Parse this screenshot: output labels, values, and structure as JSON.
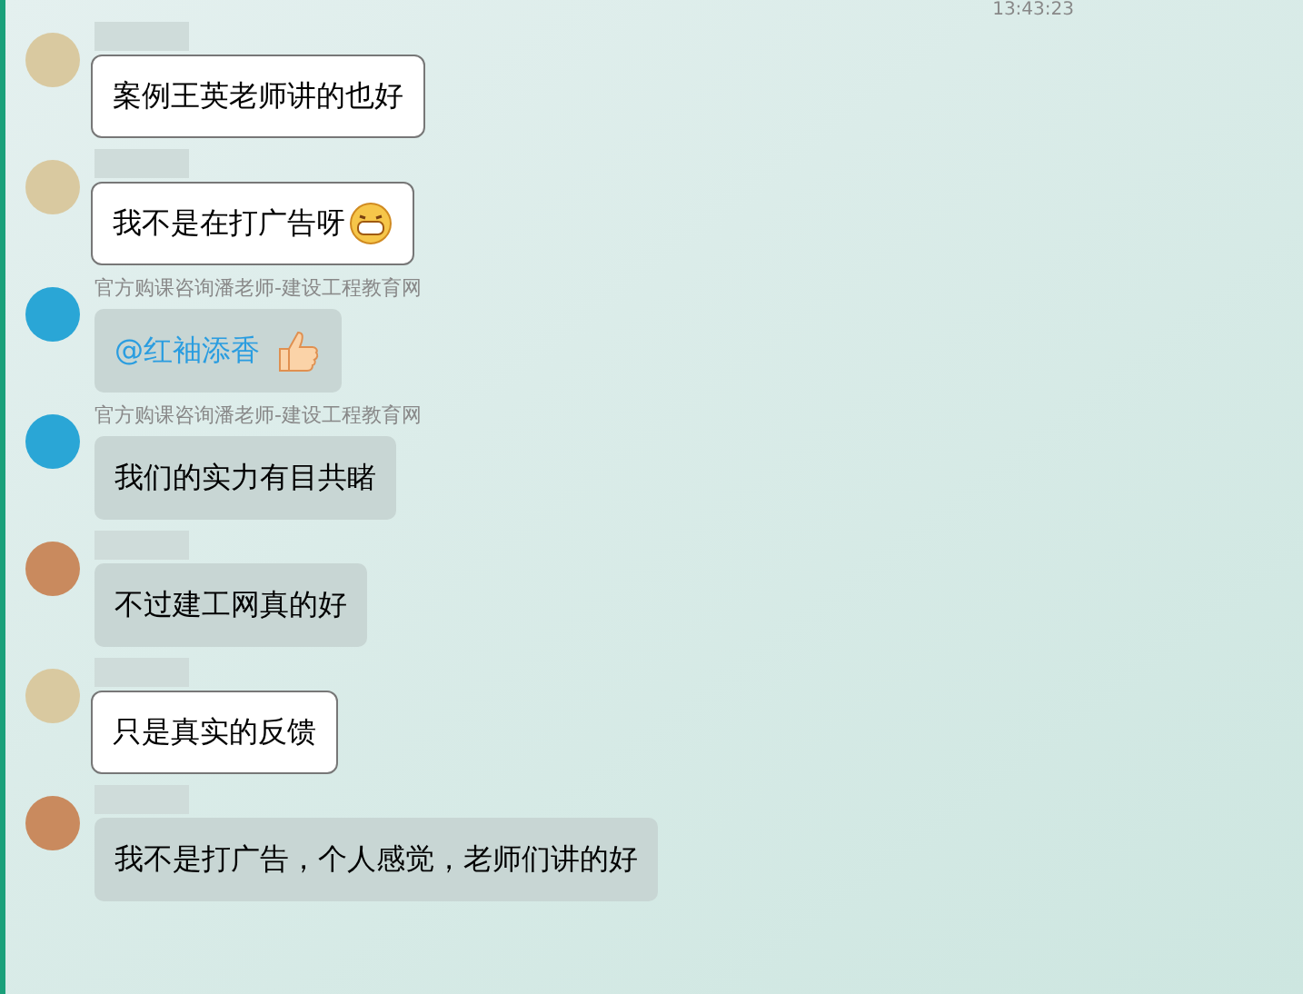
{
  "timestamp": "13:43:23",
  "messages": [
    {
      "kind": "framed",
      "avatar": {
        "kind": "cartoon"
      },
      "parts": [
        {
          "kind": "text",
          "text": "案例王英老师讲的也好"
        }
      ]
    },
    {
      "kind": "framed",
      "avatar": {
        "kind": "cartoon"
      },
      "parts": [
        {
          "kind": "text",
          "text": "我不是在打广告呀"
        },
        {
          "kind": "grin"
        }
      ]
    },
    {
      "kind": "plain",
      "avatar": {
        "kind": "logo"
      },
      "sender": "官方购课咨询潘老师-建设工程教育网",
      "parts": [
        {
          "kind": "mention",
          "text": "@红袖添香"
        },
        {
          "kind": "thumbs"
        }
      ]
    },
    {
      "kind": "plain",
      "avatar": {
        "kind": "logo"
      },
      "sender": "官方购课咨询潘老师-建设工程教育网",
      "parts": [
        {
          "kind": "text",
          "text": "我们的实力有目共睹"
        }
      ]
    },
    {
      "kind": "plain",
      "avatar": {
        "kind": "girl"
      },
      "parts": [
        {
          "kind": "text",
          "text": "不过建工网真的好"
        }
      ]
    },
    {
      "kind": "framed",
      "avatar": {
        "kind": "cartoon"
      },
      "parts": [
        {
          "kind": "text",
          "text": "只是真实的反馈"
        }
      ]
    },
    {
      "kind": "plain",
      "avatar": {
        "kind": "girl"
      },
      "parts": [
        {
          "kind": "text",
          "text": "我不是打广告，个人感觉，老师们讲的好"
        }
      ]
    }
  ]
}
